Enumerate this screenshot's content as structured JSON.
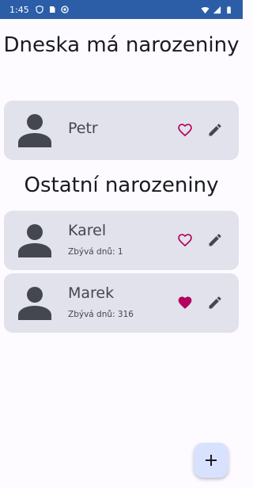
{
  "status_bar": {
    "time": "1:45",
    "background": "#2c5ea8",
    "left_icons": [
      "shield-icon",
      "sim-card-icon",
      "sync-icon"
    ],
    "right_icons": [
      "wifi-icon",
      "signal-icon",
      "battery-icon"
    ]
  },
  "today_section": {
    "title": "Dneska má narozeniny"
  },
  "others_section": {
    "title": "Ostatní narozeniny"
  },
  "cards": [
    {
      "name": "Petr",
      "subtitle": "",
      "favorite": false,
      "icon": "person-icon"
    },
    {
      "name": "Karel",
      "subtitle": "Zbývá dnů: 1",
      "favorite": false,
      "icon": "person-icon"
    },
    {
      "name": "Marek",
      "subtitle": "Zbývá dnů: 316",
      "favorite": true,
      "icon": "person-icon"
    }
  ],
  "colors": {
    "card_bg": "#e1e2ec",
    "heart": "#b5005f",
    "icon_dark": "#44474f",
    "fab_bg": "#d8e2ff"
  },
  "fab": {
    "icon": "plus-icon"
  }
}
